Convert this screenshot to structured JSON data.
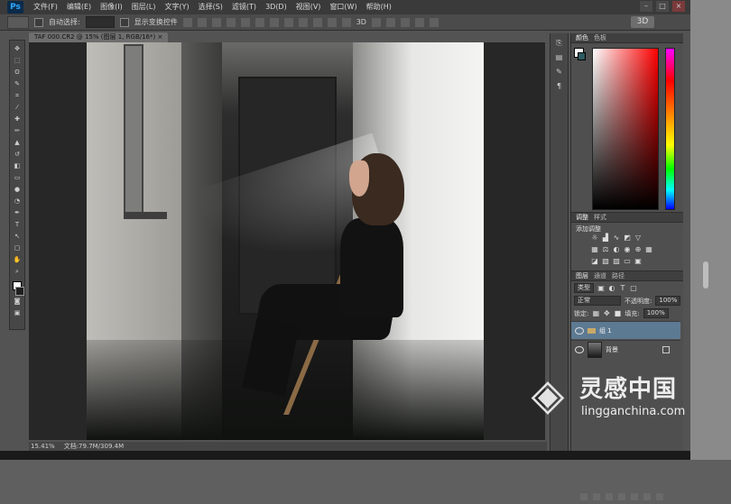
{
  "app": {
    "logo": "Ps"
  },
  "menubar": {
    "items": [
      "文件(F)",
      "编辑(E)",
      "图像(I)",
      "图层(L)",
      "文字(Y)",
      "选择(S)",
      "滤镜(T)",
      "3D(D)",
      "视图(V)",
      "窗口(W)",
      "帮助(H)"
    ]
  },
  "window_controls": {
    "minimize": "–",
    "maximize": "□",
    "close": "×"
  },
  "options_bar": {
    "auto_select_label": "自动选择:",
    "show_transform_label": "显示变换控件",
    "mode_3d_label": "3D"
  },
  "document": {
    "tab_label": "TAF 000.CR2 @ 15% (图层 1, RGB/16*) ×"
  },
  "panels": {
    "color_tabs": [
      "颜色",
      "色板"
    ],
    "adjust_tabs": [
      "调整",
      "样式"
    ],
    "adjust_title": "添加调整",
    "layers_tabs": [
      "图层",
      "通道",
      "路径"
    ],
    "kind_label": "类型",
    "blend_mode": "正常",
    "opacity_label": "不透明度:",
    "opacity_value": "100%",
    "lock_label": "锁定:",
    "fill_label": "填充:",
    "fill_value": "100%",
    "layers": [
      {
        "name": "组 1",
        "type": "group",
        "selected": true
      },
      {
        "name": "背景",
        "type": "image",
        "selected": false
      }
    ]
  },
  "statusbar": {
    "zoom": "15.41%",
    "doc_info": "文档:79.7M/309.4M"
  },
  "watermark": {
    "brand_cn": "灵感中国",
    "url": "lingganchina.com"
  },
  "colors": {
    "app_bg": "#535353",
    "menubar_bg": "#3a3a3a",
    "selection_blue": "#5d7a93",
    "ps_blue": "#31a8ff"
  }
}
